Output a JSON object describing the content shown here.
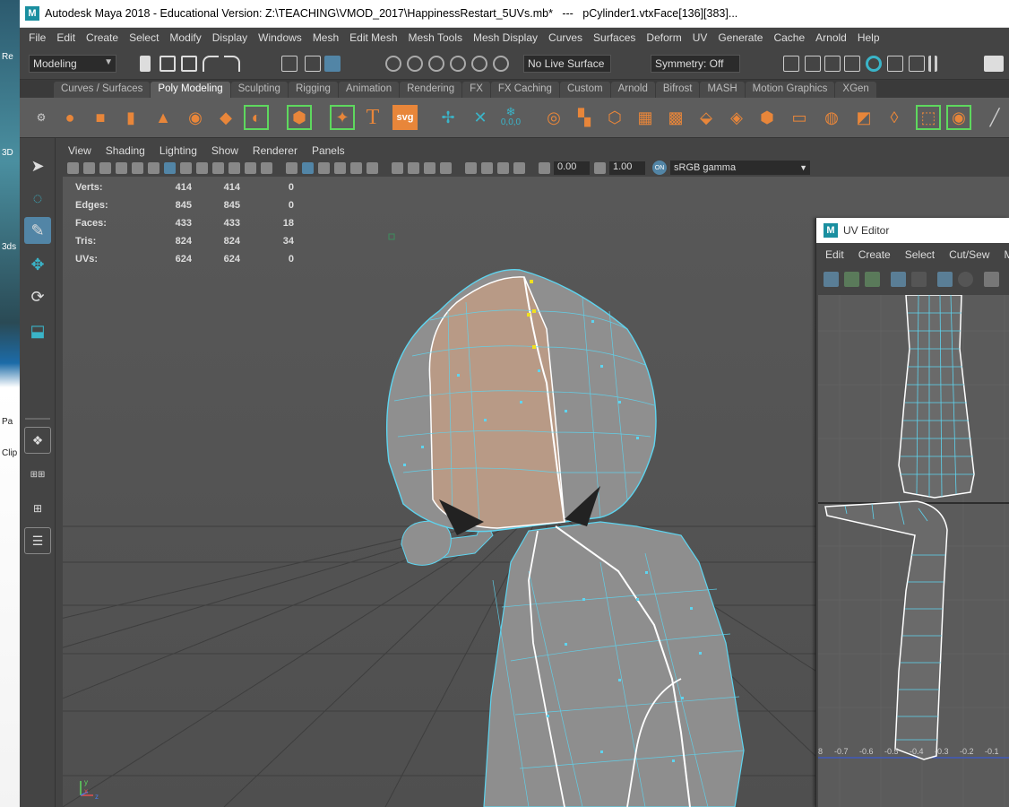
{
  "desktop": {
    "labels": [
      "Re",
      "3D",
      "3ds",
      "Pa",
      "Clip"
    ]
  },
  "window": {
    "logo": "M",
    "title": "Autodesk Maya 2018 - Educational Version: Z:\\TEACHING\\VMOD_2017\\HappinessRestart_5UVs.mb*   ---   pCylinder1.vtxFace[136][383]..."
  },
  "menubar": [
    "File",
    "Edit",
    "Create",
    "Select",
    "Modify",
    "Display",
    "Windows",
    "Mesh",
    "Edit Mesh",
    "Mesh Tools",
    "Mesh Display",
    "Curves",
    "Surfaces",
    "Deform",
    "UV",
    "Generate",
    "Cache",
    "Arnold",
    "Help"
  ],
  "statusline": {
    "menu_set": "Modeling",
    "live_surface": "No Live Surface",
    "symmetry": "Symmetry: Off"
  },
  "shelf_tabs": [
    {
      "label": "Curves / Surfaces",
      "active": false
    },
    {
      "label": "Poly Modeling",
      "active": true
    },
    {
      "label": "Sculpting",
      "active": false
    },
    {
      "label": "Rigging",
      "active": false
    },
    {
      "label": "Animation",
      "active": false
    },
    {
      "label": "Rendering",
      "active": false
    },
    {
      "label": "FX",
      "active": false
    },
    {
      "label": "FX Caching",
      "active": false
    },
    {
      "label": "Custom",
      "active": false
    },
    {
      "label": "Arnold",
      "active": false
    },
    {
      "label": "Bifrost",
      "active": false
    },
    {
      "label": "MASH",
      "active": false
    },
    {
      "label": "Motion Graphics",
      "active": false
    },
    {
      "label": "XGen",
      "active": false
    }
  ],
  "shelf_texts": {
    "type_tool": "T",
    "svg_tool": "svg",
    "origin_label": "0,0,0"
  },
  "panel_menu": [
    "View",
    "Shading",
    "Lighting",
    "Show",
    "Renderer",
    "Panels"
  ],
  "panel_toolbar": {
    "exposure": "0.00",
    "gamma": "1.00",
    "colorspace": "sRGB gamma",
    "color_mgmt_badge": "ON"
  },
  "hud": [
    {
      "label": "Verts:",
      "v1": "414",
      "v2": "414",
      "v3": "0"
    },
    {
      "label": "Edges:",
      "v1": "845",
      "v2": "845",
      "v3": "0"
    },
    {
      "label": "Faces:",
      "v1": "433",
      "v2": "433",
      "v3": "18"
    },
    {
      "label": "Tris:",
      "v1": "824",
      "v2": "824",
      "v3": "34"
    },
    {
      "label": "UVs:",
      "v1": "624",
      "v2": "624",
      "v3": "0"
    }
  ],
  "axis_labels": {
    "y": "y",
    "x": "x",
    "z": "z"
  },
  "uv_editor": {
    "logo": "M",
    "title": "UV Editor",
    "menu": [
      "Edit",
      "Create",
      "Select",
      "Cut/Sew",
      "Mo"
    ],
    "ticks": [
      "8",
      "-0.7",
      "-0.6",
      "-0.5",
      "-0.4",
      "-0.3",
      "-0.2",
      "-0.1"
    ]
  },
  "colors": {
    "wire": "#5ed4ef",
    "selected_face": "#b89a86",
    "accent": "#5285a6",
    "shelf_icon": "#e8863a"
  }
}
